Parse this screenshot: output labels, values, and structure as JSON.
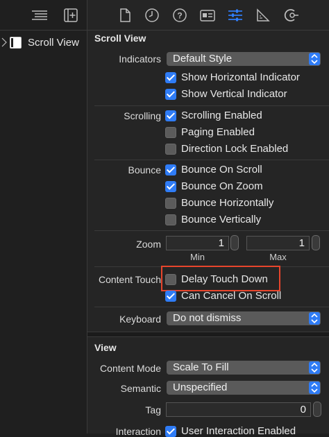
{
  "navigator": {
    "tree": [
      {
        "label": "Scroll View"
      }
    ]
  },
  "inspector": {
    "tabs": [
      "file-icon",
      "history-icon",
      "help-icon",
      "identity-icon",
      "attributes-icon",
      "size-icon",
      "connections-icon"
    ],
    "scroll_view": {
      "title": "Scroll View",
      "indicators": {
        "label": "Indicators",
        "value": "Default Style"
      },
      "show_horizontal": {
        "label": "Show Horizontal Indicator",
        "checked": true
      },
      "show_vertical": {
        "label": "Show Vertical Indicator",
        "checked": true
      },
      "scrolling_label": "Scrolling",
      "scrolling_enabled": {
        "label": "Scrolling Enabled",
        "checked": true
      },
      "paging_enabled": {
        "label": "Paging Enabled",
        "checked": false
      },
      "direction_lock": {
        "label": "Direction Lock Enabled",
        "checked": false
      },
      "bounce_label": "Bounce",
      "bounce_on_scroll": {
        "label": "Bounce On Scroll",
        "checked": true
      },
      "bounce_on_zoom": {
        "label": "Bounce On Zoom",
        "checked": true
      },
      "bounce_horizontally": {
        "label": "Bounce Horizontally",
        "checked": false
      },
      "bounce_vertically": {
        "label": "Bounce Vertically",
        "checked": false
      },
      "zoom": {
        "label": "Zoom",
        "min_value": "1",
        "max_value": "1",
        "min_label": "Min",
        "max_label": "Max"
      },
      "content_touch_label": "Content Touch",
      "delay_touch_down": {
        "label": "Delay Touch Down",
        "checked": false
      },
      "can_cancel_on_scroll": {
        "label": "Can Cancel On Scroll",
        "checked": true
      },
      "keyboard": {
        "label": "Keyboard",
        "value": "Do not dismiss"
      }
    },
    "view": {
      "title": "View",
      "content_mode": {
        "label": "Content Mode",
        "value": "Scale To Fill"
      },
      "semantic": {
        "label": "Semantic",
        "value": "Unspecified"
      },
      "tag": {
        "label": "Tag",
        "value": "0"
      },
      "interaction": {
        "label": "Interaction",
        "value": "User Interaction Enabled",
        "checked": true
      }
    }
  },
  "colors": {
    "accent": "#2f7cf6",
    "highlight": "#e8452c",
    "background": "#252525"
  }
}
